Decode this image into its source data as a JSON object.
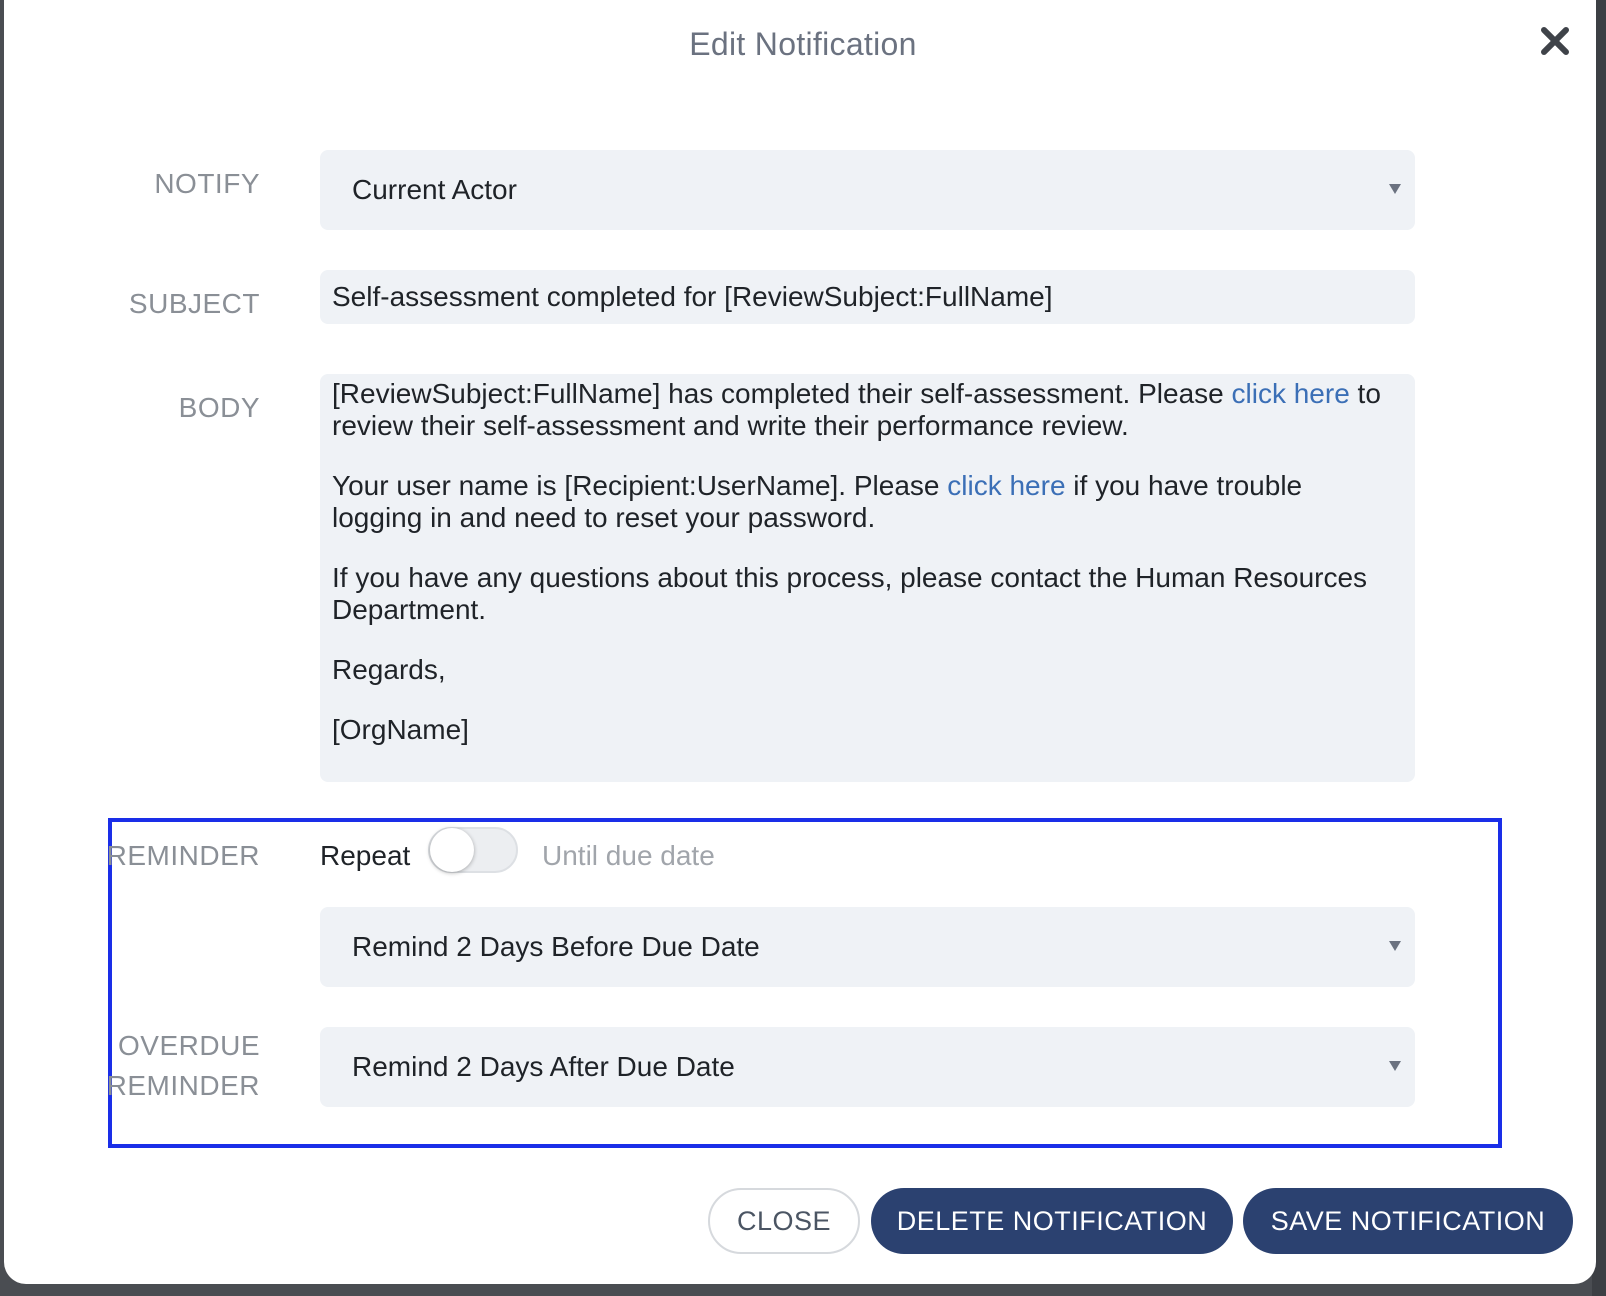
{
  "dialog": {
    "title": "Edit Notification"
  },
  "labels": {
    "notify": "NOTIFY",
    "subject": "SUBJECT",
    "body": "BODY",
    "reminder": "REMINDER",
    "overdue_line1": "OVERDUE",
    "overdue_line2": "REMINDER"
  },
  "fields": {
    "notify_value": "Current Actor",
    "subject_value": "Self-assessment completed for [ReviewSubject:FullName]",
    "body": {
      "p1_part1": "[ReviewSubject:FullName] has completed their self-assessment. Please ",
      "p1_link": "click here",
      "p1_part2": " to review their self-assessment and write their performance review.",
      "p2_part1": "Your user name is [Recipient:UserName]. Please ",
      "p2_link": "click here",
      "p2_part2": " if you have trouble logging in and need to reset your password.",
      "p3": "If you have any questions about this process, please contact the Human Resources Department.",
      "p4": "Regards,",
      "p5": "[OrgName]"
    },
    "repeat_label": "Repeat",
    "repeat_enabled": false,
    "until_label": "Until due date",
    "reminder_value": "Remind 2 Days Before Due Date",
    "overdue_value": "Remind 2 Days After Due Date"
  },
  "buttons": {
    "close": "CLOSE",
    "delete": "DELETE NOTIFICATION",
    "save": "SAVE NOTIFICATION"
  },
  "colors": {
    "primary_button": "#2b4170",
    "link": "#3b6fb6",
    "highlight_border": "#1a2ee8",
    "field_background": "#eff2f6"
  },
  "icons": {
    "close": "close-icon",
    "dropdown": "chevron-down-icon"
  }
}
